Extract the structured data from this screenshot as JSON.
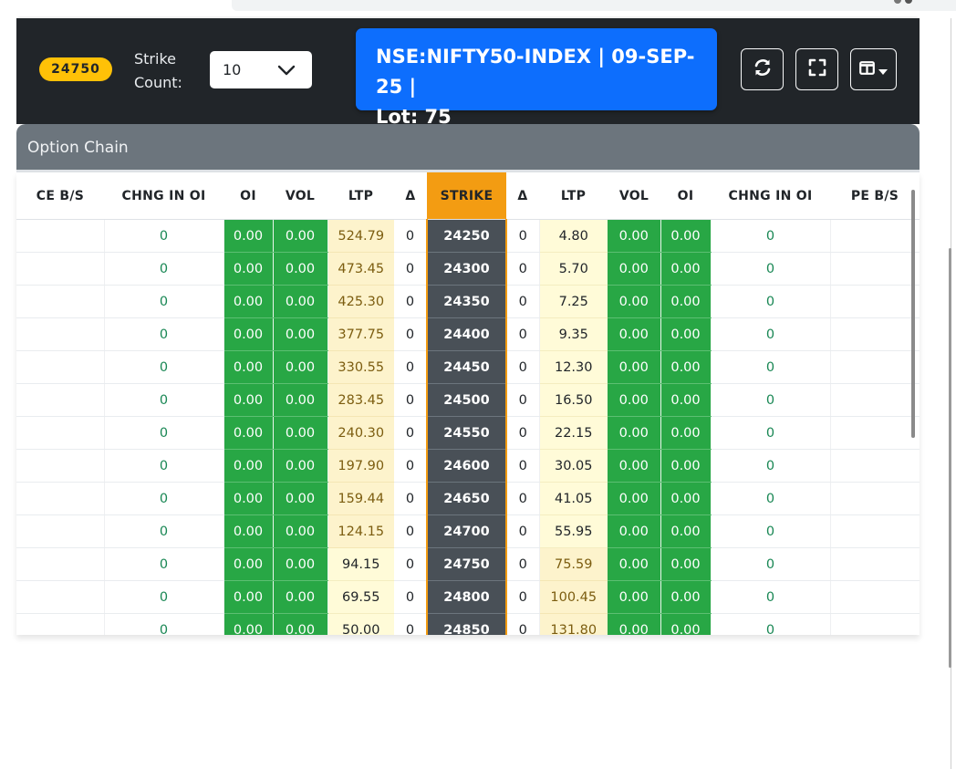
{
  "toolbar": {
    "spot_price": "24750",
    "strike_count_label_1": "Strike",
    "strike_count_label_2": "Count:",
    "strike_count_value": "10",
    "info_line1": "NSE:NIFTY50-INDEX | 09-SEP-25 |",
    "info_line2": "Lot: 75",
    "icons": {
      "refresh": "refresh-icon",
      "fullscreen": "fullscreen-icon",
      "columns": "columns-icon",
      "caret": "caret-down-icon"
    }
  },
  "chain": {
    "title": "Option Chain",
    "columns": [
      "CE B/S",
      "CHNG IN OI",
      "OI",
      "VOL",
      "LTP",
      "Δ",
      "STRIKE",
      "Δ",
      "LTP",
      "VOL",
      "OI",
      "CHNG IN OI",
      "PE B/S"
    ],
    "rows": [
      {
        "ce_chg": "0",
        "ce_oi": "0.00",
        "ce_vol": "0.00",
        "ce_ltp": "524.79",
        "ce_delta": "0",
        "strike": "24250",
        "pe_delta": "0",
        "pe_ltp": "4.80",
        "pe_vol": "0.00",
        "pe_oi": "0.00",
        "pe_chg": "0",
        "ce_itm": true,
        "pe_itm": false
      },
      {
        "ce_chg": "0",
        "ce_oi": "0.00",
        "ce_vol": "0.00",
        "ce_ltp": "473.45",
        "ce_delta": "0",
        "strike": "24300",
        "pe_delta": "0",
        "pe_ltp": "5.70",
        "pe_vol": "0.00",
        "pe_oi": "0.00",
        "pe_chg": "0",
        "ce_itm": true,
        "pe_itm": false
      },
      {
        "ce_chg": "0",
        "ce_oi": "0.00",
        "ce_vol": "0.00",
        "ce_ltp": "425.30",
        "ce_delta": "0",
        "strike": "24350",
        "pe_delta": "0",
        "pe_ltp": "7.25",
        "pe_vol": "0.00",
        "pe_oi": "0.00",
        "pe_chg": "0",
        "ce_itm": true,
        "pe_itm": false
      },
      {
        "ce_chg": "0",
        "ce_oi": "0.00",
        "ce_vol": "0.00",
        "ce_ltp": "377.75",
        "ce_delta": "0",
        "strike": "24400",
        "pe_delta": "0",
        "pe_ltp": "9.35",
        "pe_vol": "0.00",
        "pe_oi": "0.00",
        "pe_chg": "0",
        "ce_itm": true,
        "pe_itm": false
      },
      {
        "ce_chg": "0",
        "ce_oi": "0.00",
        "ce_vol": "0.00",
        "ce_ltp": "330.55",
        "ce_delta": "0",
        "strike": "24450",
        "pe_delta": "0",
        "pe_ltp": "12.30",
        "pe_vol": "0.00",
        "pe_oi": "0.00",
        "pe_chg": "0",
        "ce_itm": true,
        "pe_itm": false
      },
      {
        "ce_chg": "0",
        "ce_oi": "0.00",
        "ce_vol": "0.00",
        "ce_ltp": "283.45",
        "ce_delta": "0",
        "strike": "24500",
        "pe_delta": "0",
        "pe_ltp": "16.50",
        "pe_vol": "0.00",
        "pe_oi": "0.00",
        "pe_chg": "0",
        "ce_itm": true,
        "pe_itm": false
      },
      {
        "ce_chg": "0",
        "ce_oi": "0.00",
        "ce_vol": "0.00",
        "ce_ltp": "240.30",
        "ce_delta": "0",
        "strike": "24550",
        "pe_delta": "0",
        "pe_ltp": "22.15",
        "pe_vol": "0.00",
        "pe_oi": "0.00",
        "pe_chg": "0",
        "ce_itm": true,
        "pe_itm": false
      },
      {
        "ce_chg": "0",
        "ce_oi": "0.00",
        "ce_vol": "0.00",
        "ce_ltp": "197.90",
        "ce_delta": "0",
        "strike": "24600",
        "pe_delta": "0",
        "pe_ltp": "30.05",
        "pe_vol": "0.00",
        "pe_oi": "0.00",
        "pe_chg": "0",
        "ce_itm": true,
        "pe_itm": false
      },
      {
        "ce_chg": "0",
        "ce_oi": "0.00",
        "ce_vol": "0.00",
        "ce_ltp": "159.44",
        "ce_delta": "0",
        "strike": "24650",
        "pe_delta": "0",
        "pe_ltp": "41.05",
        "pe_vol": "0.00",
        "pe_oi": "0.00",
        "pe_chg": "0",
        "ce_itm": true,
        "pe_itm": false
      },
      {
        "ce_chg": "0",
        "ce_oi": "0.00",
        "ce_vol": "0.00",
        "ce_ltp": "124.15",
        "ce_delta": "0",
        "strike": "24700",
        "pe_delta": "0",
        "pe_ltp": "55.95",
        "pe_vol": "0.00",
        "pe_oi": "0.00",
        "pe_chg": "0",
        "ce_itm": true,
        "pe_itm": false
      },
      {
        "ce_chg": "0",
        "ce_oi": "0.00",
        "ce_vol": "0.00",
        "ce_ltp": "94.15",
        "ce_delta": "0",
        "strike": "24750",
        "pe_delta": "0",
        "pe_ltp": "75.59",
        "pe_vol": "0.00",
        "pe_oi": "0.00",
        "pe_chg": "0",
        "ce_itm": false,
        "pe_itm": true
      },
      {
        "ce_chg": "0",
        "ce_oi": "0.00",
        "ce_vol": "0.00",
        "ce_ltp": "69.55",
        "ce_delta": "0",
        "strike": "24800",
        "pe_delta": "0",
        "pe_ltp": "100.45",
        "pe_vol": "0.00",
        "pe_oi": "0.00",
        "pe_chg": "0",
        "ce_itm": false,
        "pe_itm": true
      },
      {
        "ce_chg": "0",
        "ce_oi": "0.00",
        "ce_vol": "0.00",
        "ce_ltp": "50.00",
        "ce_delta": "0",
        "strike": "24850",
        "pe_delta": "0",
        "pe_ltp": "131.80",
        "pe_vol": "0.00",
        "pe_oi": "0.00",
        "pe_chg": "0",
        "ce_itm": false,
        "pe_itm": true
      }
    ]
  },
  "colors": {
    "toolbar_bg": "#212529",
    "spot_badge": "#ffc107",
    "info_box": "#0d6efd",
    "chain_header": "#6c757d",
    "oi_vol_green": "#28a745",
    "strike_header": "#f39c12",
    "strike_cell": "#495057",
    "ltp_itm": "#fdf3cc",
    "ltp_otm": "#fffbd8",
    "change_text": "#198754"
  }
}
